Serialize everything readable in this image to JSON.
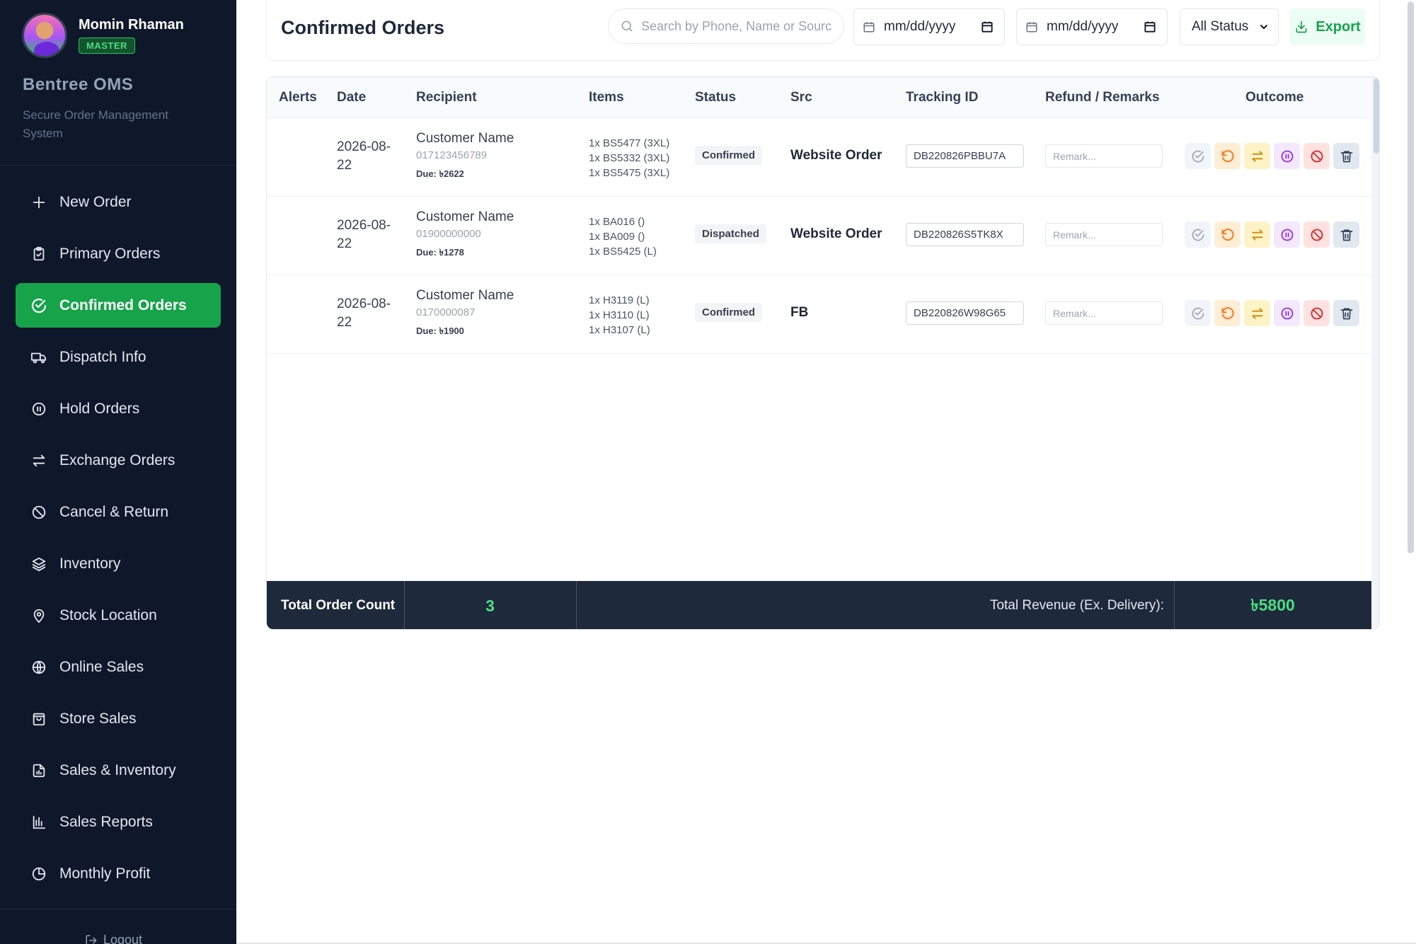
{
  "sidebar": {
    "user_name": "Momin Rhaman",
    "role_badge": "MASTER",
    "brand": "Bentree OMS",
    "tagline": "Secure Order Management System",
    "items": [
      {
        "label": "New Order",
        "icon": "plus-icon"
      },
      {
        "label": "Primary Orders",
        "icon": "clipboard-icon"
      },
      {
        "label": "Confirmed Orders",
        "icon": "check-circle-icon",
        "active": true
      },
      {
        "label": "Dispatch Info",
        "icon": "truck-icon"
      },
      {
        "label": "Hold Orders",
        "icon": "pause-circle-icon"
      },
      {
        "label": "Exchange Orders",
        "icon": "arrows-exchange-icon"
      },
      {
        "label": "Cancel & Return",
        "icon": "ban-icon"
      },
      {
        "label": "Inventory",
        "icon": "layers-icon"
      },
      {
        "label": "Stock Location",
        "icon": "map-pin-icon"
      },
      {
        "label": "Online Sales",
        "icon": "globe-icon"
      },
      {
        "label": "Store Sales",
        "icon": "shopping-bag-icon"
      },
      {
        "label": "Sales & Inventory",
        "icon": "document-chart-icon"
      },
      {
        "label": "Sales Reports",
        "icon": "bar-chart-icon"
      },
      {
        "label": "Monthly Profit",
        "icon": "pie-chart-icon"
      }
    ],
    "logout_label": "Logout"
  },
  "header": {
    "title": "Confirmed Orders",
    "search_placeholder": "Search by Phone, Name or Source...",
    "date_from": "mm/dd/yyyy",
    "date_to": "mm/dd/yyyy",
    "status_filter": "All Status",
    "export_label": "Export"
  },
  "table": {
    "columns": [
      "Alerts",
      "Date",
      "Recipient",
      "Items",
      "Status",
      "Src",
      "Tracking ID",
      "Refund / Remarks",
      "Outcome"
    ],
    "remark_placeholder": "Remark...",
    "rows": [
      {
        "date": "2026-08-22",
        "recipient_name": "Customer Name",
        "phone": "017123456789",
        "due": "Due: ৳2622",
        "items": "1x BS5477 (3XL)\n1x BS5332 (3XL)\n1x BS5475 (3XL)",
        "status": "Confirmed",
        "src": "Website Order",
        "tracking_id": "DB220826PBBU7A"
      },
      {
        "date": "2026-08-22",
        "recipient_name": "Customer Name",
        "phone": "01900000000",
        "due": "Due: ৳1278",
        "items": "1x BA016 ()\n1x BA009 ()\n1x BS5425 (L)",
        "status": "Dispatched",
        "src": "Website Order",
        "tracking_id": "DB220826S5TK8X"
      },
      {
        "date": "2026-08-22",
        "recipient_name": "Customer Name",
        "phone": "0170000087",
        "due": "Due: ৳1900",
        "items": "1x H3119 (L)\n1x H3110 (L)\n1x H3107 (L)",
        "status": "Confirmed",
        "src": "FB",
        "tracking_id": "DB220826W98G65"
      }
    ]
  },
  "footer": {
    "count_label": "Total Order Count",
    "count_value": "3",
    "revenue_label": "Total Revenue (Ex. Delivery):",
    "revenue_value": "৳5800"
  },
  "colors": {
    "sidebar_bg": "#0f172a",
    "accent_green": "#16a34a",
    "footer_bg": "#1e293b"
  }
}
